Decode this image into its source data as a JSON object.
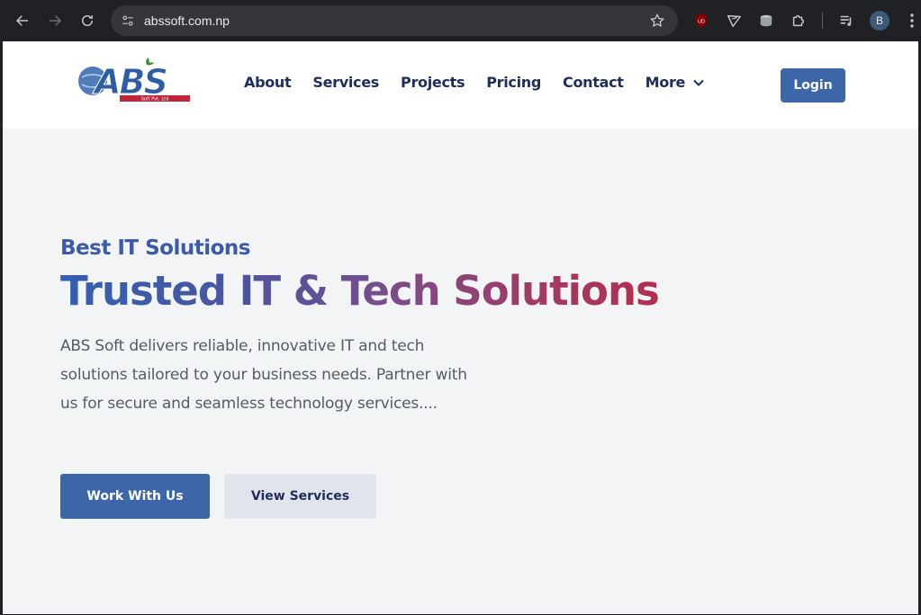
{
  "browser": {
    "url": "abssoft.com.np",
    "profile_initial": "B",
    "extension_badge": "UD"
  },
  "header": {
    "logo_text": "ABS",
    "logo_tagline": "Soft Pvt. Ltd",
    "nav": [
      {
        "label": "About"
      },
      {
        "label": "Services"
      },
      {
        "label": "Projects"
      },
      {
        "label": "Pricing"
      },
      {
        "label": "Contact"
      },
      {
        "label": "More"
      }
    ],
    "login_label": "Login"
  },
  "hero": {
    "subtitle": "Best IT Solutions",
    "title": "Trusted IT & Tech Solutions",
    "description": "ABS Soft delivers reliable, innovative IT and tech solutions tailored to your business needs. Partner with us for secure and seamless technology services....",
    "primary_button": "Work With Us",
    "secondary_button": "View Services"
  },
  "colors": {
    "brand_blue": "#3d66a8",
    "nav_text": "#1f2d5c",
    "title_gradient_start": "#3260b0",
    "title_gradient_end": "#b22e4e"
  }
}
